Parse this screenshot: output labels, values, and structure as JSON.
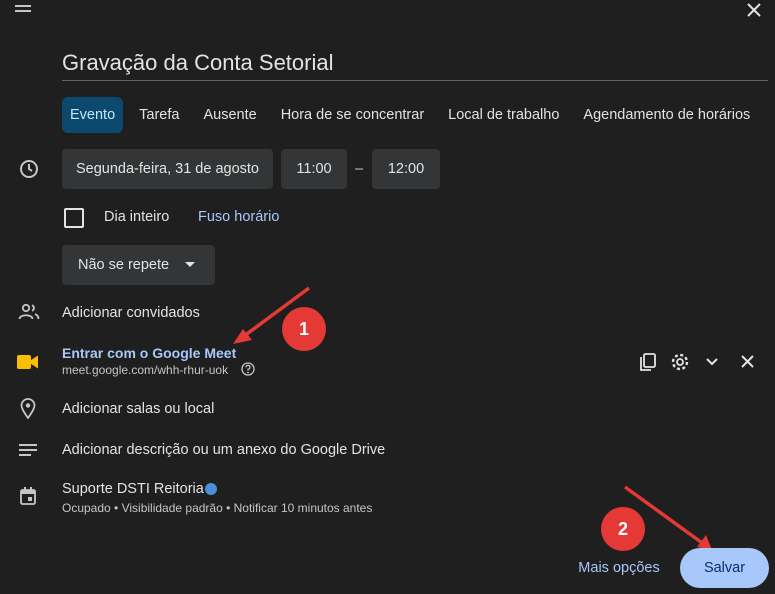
{
  "header": {
    "title": "Gravação da Conta Setorial"
  },
  "tabs": [
    {
      "label": "Evento"
    },
    {
      "label": "Tarefa"
    },
    {
      "label": "Ausente"
    },
    {
      "label": "Hora de se concentrar"
    },
    {
      "label": "Local de trabalho"
    },
    {
      "label": "Agendamento de horários"
    }
  ],
  "datetime": {
    "date": "Segunda-feira, 31 de agosto",
    "start": "11:00",
    "separator": "–",
    "end": "12:00"
  },
  "allday": {
    "label": "Dia inteiro",
    "checked": false,
    "timezone_link": "Fuso horário"
  },
  "repeat": {
    "value": "Não se repete"
  },
  "guests": {
    "label": "Adicionar convidados"
  },
  "meet": {
    "join_label": "Entrar com o Google Meet",
    "url": "meet.google.com/whh-rhur-uok"
  },
  "location": {
    "label": "Adicionar salas ou local"
  },
  "description": {
    "label": "Adicionar descrição ou um anexo do Google Drive"
  },
  "calendar": {
    "name": "Suporte DSTI Reitoria",
    "details": "Ocupado • Visibilidade padrão • Notificar 10 minutos antes",
    "color": "#4a90d9"
  },
  "annotations": {
    "badge1": "1",
    "badge2": "2"
  },
  "footer": {
    "more_options": "Mais opções",
    "save": "Salvar"
  },
  "colors": {
    "background": "#1f1f1f",
    "accent": "#a8c7fa",
    "active_tab": "#0b4a6e",
    "annotation": "#e53935"
  }
}
